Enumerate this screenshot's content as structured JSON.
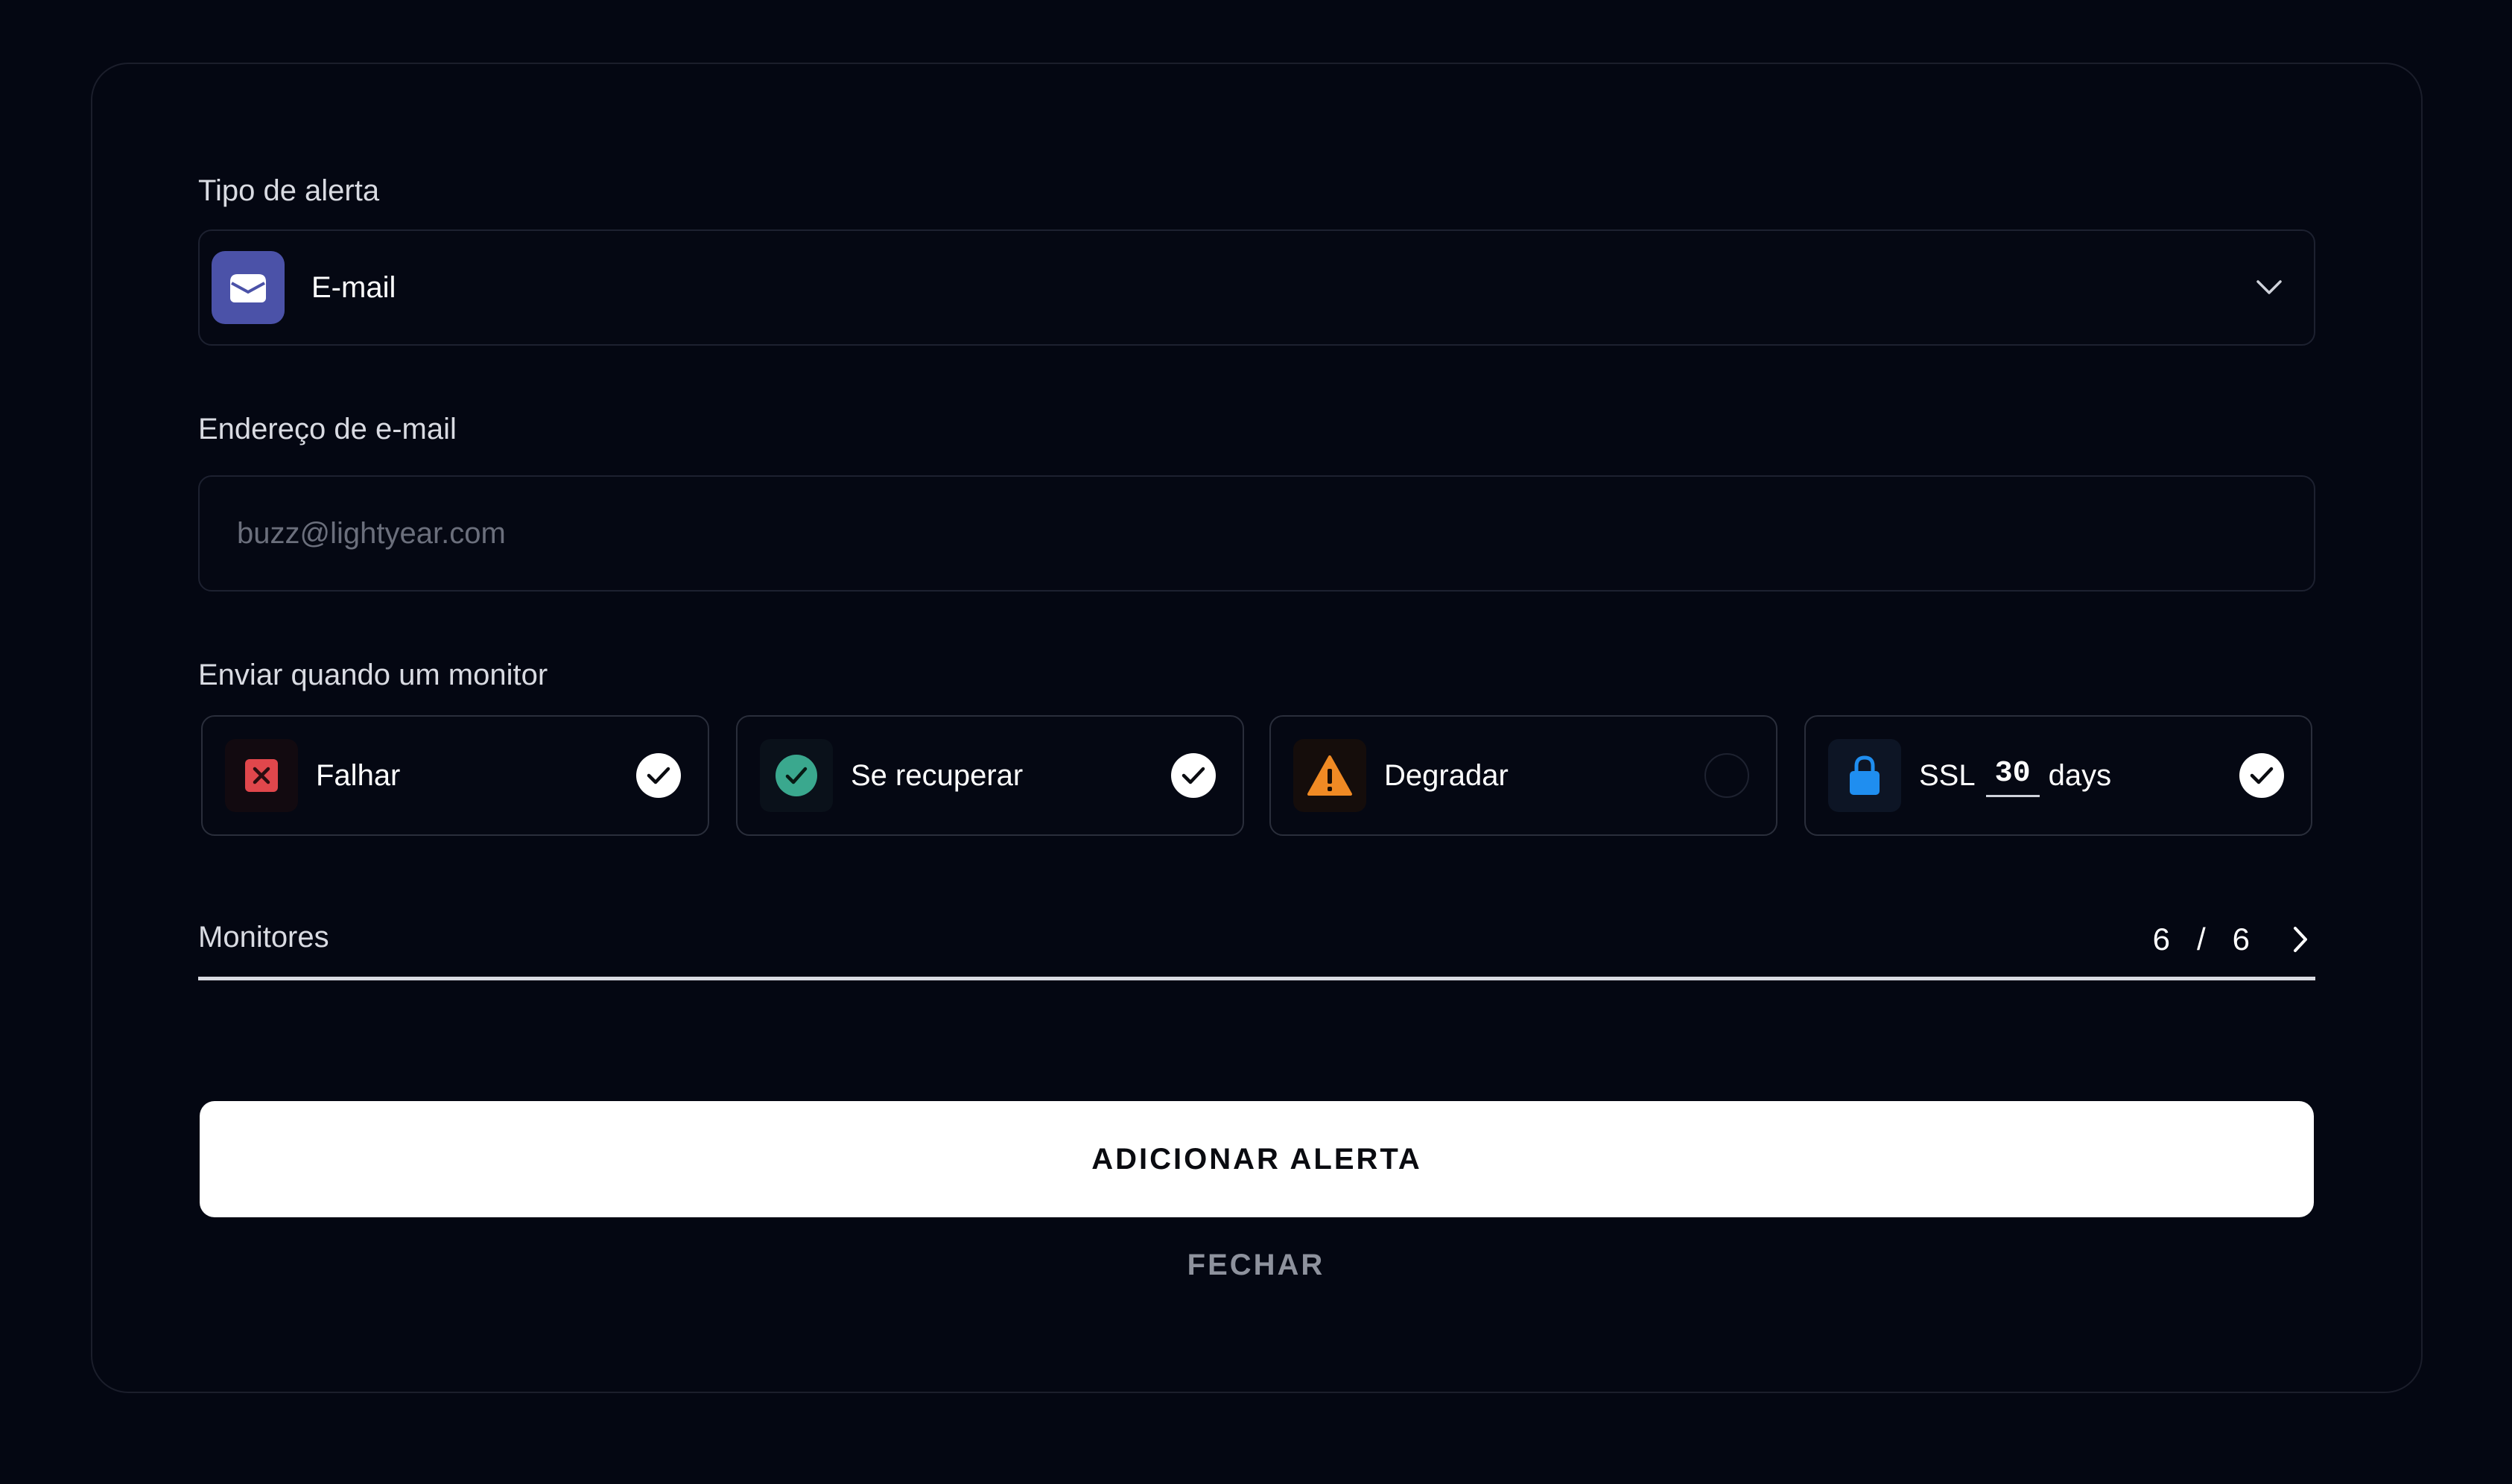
{
  "form": {
    "alert_type_label": "Tipo de alerta",
    "alert_type_value": "E-mail",
    "email_label": "Endereço de e-mail",
    "email_placeholder": "buzz@lightyear.com",
    "email_value": "",
    "send_when_label": "Enviar quando um monitor"
  },
  "triggers": [
    {
      "label": "Falhar",
      "icon": "x-square-icon",
      "checked": true,
      "color": "#e0474c"
    },
    {
      "label": "Se recuperar",
      "icon": "check-circle-icon",
      "checked": true,
      "color": "#3aa88e"
    },
    {
      "label": "Degradar",
      "icon": "warning-triangle-icon",
      "checked": false,
      "color": "#f08a24"
    },
    {
      "label": "SSL",
      "icon": "lock-icon",
      "checked": true,
      "color": "#1f8ef0",
      "days_value": "30",
      "days_suffix": "days"
    }
  ],
  "monitors": {
    "label": "Monitores",
    "selected": "6",
    "separator": "/",
    "total": "6"
  },
  "actions": {
    "add_label": "ADICIONAR ALERTA",
    "close_label": "FECHAR"
  },
  "colors": {
    "background": "#040712",
    "email_icon_bg": "#4b52a8",
    "primary_button": "#ffffff"
  }
}
